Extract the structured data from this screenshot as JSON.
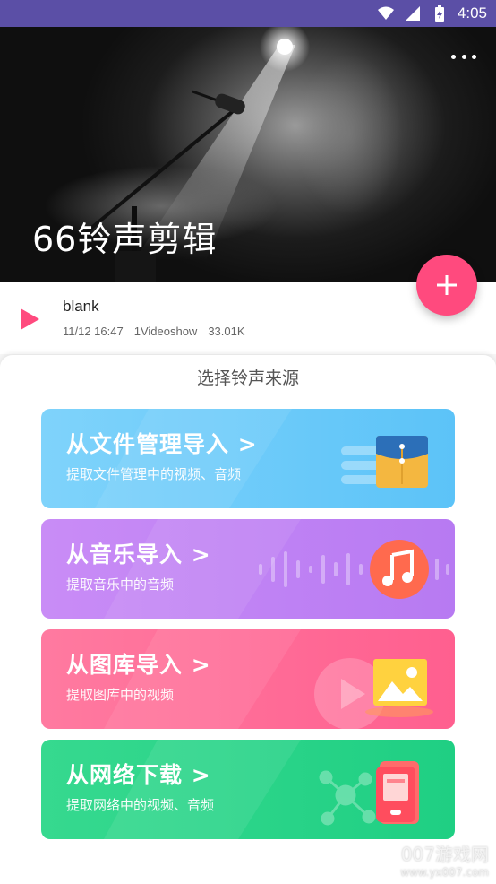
{
  "status_bar": {
    "time": "4:05",
    "icons": [
      "wifi-icon",
      "signal-icon",
      "battery-icon"
    ]
  },
  "hero": {
    "title": "66铃声剪辑"
  },
  "track": {
    "name": "blank",
    "date": "11/12 16:47",
    "source": "1Videoshow",
    "size": "33.01K"
  },
  "sheet": {
    "title": "选择铃声来源",
    "cards": [
      {
        "title": "从文件管理导入 >",
        "subtitle": "提取文件管理中的视频、音频",
        "icon": "folder-icon",
        "color": "#5cc3f8"
      },
      {
        "title": "从音乐导入 >",
        "subtitle": "提取音乐中的音频",
        "icon": "music-note-icon",
        "color": "#b77af2"
      },
      {
        "title": "从图库导入 >",
        "subtitle": "提取图库中的视频",
        "icon": "image-icon",
        "color": "#ff5f8f"
      },
      {
        "title": "从网络下载 >",
        "subtitle": "提取网络中的视频、音频",
        "icon": "phone-download-icon",
        "color": "#1fcf83"
      }
    ]
  },
  "watermark": {
    "brand": "007游戏网",
    "url": "www.yx007.com"
  },
  "colors": {
    "status_bar": "#5b4fa6",
    "fab": "#ff4a7e",
    "play": "#ff4a7e"
  }
}
